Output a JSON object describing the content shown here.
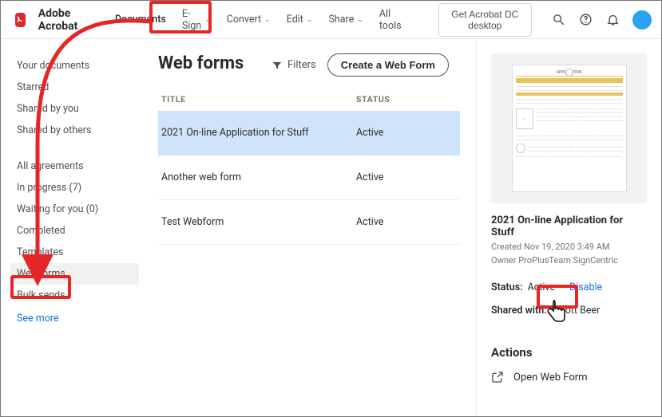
{
  "header": {
    "brand": "Adobe Acrobat",
    "nav": {
      "documents": "Documents",
      "esign": "E-Sign",
      "convert": "Convert",
      "edit": "Edit",
      "share": "Share",
      "alltools": "All tools"
    },
    "cta": "Get Acrobat DC desktop"
  },
  "sidebar": {
    "your_documents": "Your documents",
    "starred": "Starred",
    "shared_by_you": "Shared by you",
    "shared_by_others": "Shared by others",
    "all_agreements": "All agreements",
    "in_progress": "In progress (7)",
    "waiting_for_you": "Waiting for you (0)",
    "completed": "Completed",
    "templates": "Templates",
    "web_forms": "Web forms",
    "bulk_sends": "Bulk sends",
    "see_more": "See more"
  },
  "content": {
    "title": "Web forms",
    "filters": "Filters",
    "create_btn": "Create a Web Form",
    "columns": {
      "title": "TITLE",
      "status": "STATUS"
    },
    "rows": [
      {
        "title": "2021 On-line Application for Stuff",
        "status": "Active"
      },
      {
        "title": "Another web form",
        "status": "Active"
      },
      {
        "title": "Test Webform",
        "status": "Active"
      }
    ]
  },
  "right_panel": {
    "item_title": "2021 On-line Application for Stuff",
    "created": "Created Nov 19, 2020 3:49 AM",
    "owner": "Owner ProPlusTeam SignCentric",
    "status_label": "Status:",
    "status_value": "Active",
    "disable": "Disable",
    "shared_label": "Shared with:",
    "shared_value": "Scott Beer",
    "actions_heading": "Actions",
    "open_web_form": "Open Web Form"
  }
}
